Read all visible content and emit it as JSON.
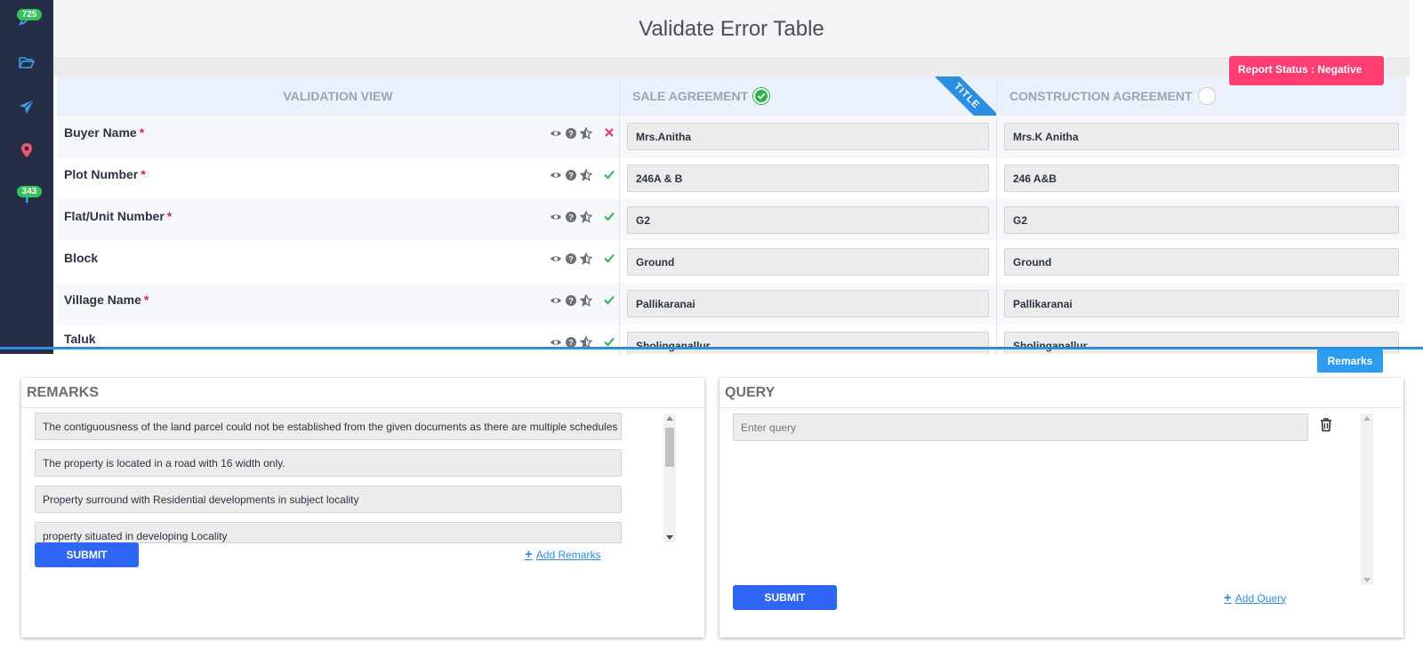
{
  "sidebar": {
    "items": [
      {
        "icon": "pen-icon",
        "badge": "725"
      },
      {
        "icon": "folder-open-icon",
        "badge": ""
      },
      {
        "icon": "paper-plane-icon",
        "badge": ""
      },
      {
        "icon": "map-marker-icon",
        "badge": ""
      },
      {
        "icon": "signpost-icon",
        "badge": "343"
      }
    ],
    "background": "#262d47",
    "badge_color": "#35c25a"
  },
  "page": {
    "title": "Validate Error Table",
    "report_status": "Report Status : Negative"
  },
  "grid": {
    "headers": {
      "validation": "VALIDATION VIEW",
      "sale": "SALE AGREEMENT",
      "construction": "CONSTRUCTION AGREEMENT",
      "ribbon": "TITLE"
    },
    "rows": [
      {
        "label": "Buyer Name",
        "required": "*",
        "status": "error",
        "sale": "Mrs.Anitha",
        "construction": "Mrs.K Anitha"
      },
      {
        "label": "Plot Number",
        "required": "*",
        "status": "ok",
        "sale": "246A & B",
        "construction": "246 A&B"
      },
      {
        "label": "Flat/Unit Number",
        "required": "*",
        "status": "ok",
        "sale": "G2",
        "construction": "G2"
      },
      {
        "label": "Block",
        "required": "",
        "status": "ok",
        "sale": "Ground",
        "construction": "Ground"
      },
      {
        "label": "Village Name",
        "required": "*",
        "status": "ok",
        "sale": "Pallikaranai",
        "construction": "Pallikaranai"
      },
      {
        "label": "Taluk",
        "required": "",
        "status": "ok",
        "sale": "Sholinganallur",
        "construction": "Sholinganallur"
      }
    ]
  },
  "remarks_tab": "Remarks",
  "remarks": {
    "title": "REMARKS",
    "items": [
      "The contiguousness of the land parcel could not be established from the given documents as there are multiple schedules",
      "The property is located in a road with 16 width only.",
      "Property surround with Residential developments in subject locality",
      "property situated in developing Locality"
    ],
    "submit_label": "SUBMIT",
    "add_label": "Add Remarks"
  },
  "query": {
    "title": "QUERY",
    "placeholder": "Enter query",
    "submit_label": "SUBMIT",
    "add_label": "Add Query"
  },
  "colors": {
    "accent": "#2d8ee0",
    "submit": "#2f66f5",
    "status_negative": "#ff3d70",
    "ok": "#2cb34a",
    "error": "#f0356b"
  }
}
